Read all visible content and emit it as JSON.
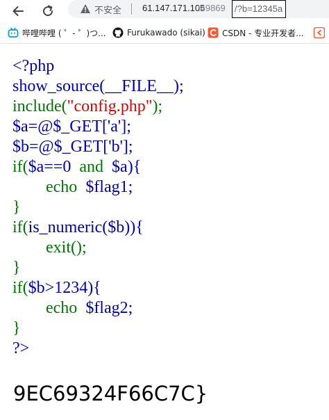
{
  "toolbar": {
    "security_label": "不安全",
    "url_host": "61.147.171.105",
    "url_port": ":49869",
    "url_query": "/?b=12345a"
  },
  "bookmarks": [
    {
      "label": "哔哩哔哩 ( ゜- ゜)つ...",
      "icon": "bilibili-icon",
      "color": "#00a1d6"
    },
    {
      "label": "Furukawado (sikai)",
      "icon": "github-icon",
      "color": "#181717"
    },
    {
      "label": "CSDN - 专业开发者...",
      "icon": "csdn-icon",
      "color": "#fc5531"
    },
    {
      "label": "",
      "icon": "bookmark-icon-partial",
      "color": "#fc5531"
    }
  ],
  "source": {
    "line1": "<?php",
    "line2": "show_source(__FILE__);",
    "line3_fn": "include(",
    "line3_str": "\"config.php\"",
    "line3_end": ");",
    "line4": "$a=@$_GET['a'];",
    "line5": "$b=@$_GET['b'];",
    "line6_kw": "if(",
    "line6_cond": "$a==0",
    "line6_and": "and",
    "line6_rest": "$a){",
    "line7_kw": "echo",
    "line7_var": "$flag1;",
    "line8": "}",
    "line9_kw": "if(",
    "line9_rest": "is_numeric($b)){",
    "line10_kw": "exit();",
    "line11": "}",
    "line12_kw": "if(",
    "line12_rest": "$b>1234){",
    "line13_kw": "echo",
    "line13_var": "$flag2;",
    "line14": "}",
    "line15": "?>"
  },
  "output": {
    "flag_text": "9EC69324F66C7C}"
  },
  "colors": {
    "php_default": "#0000bb",
    "php_keyword": "#007700",
    "php_string": "#dd0000"
  }
}
